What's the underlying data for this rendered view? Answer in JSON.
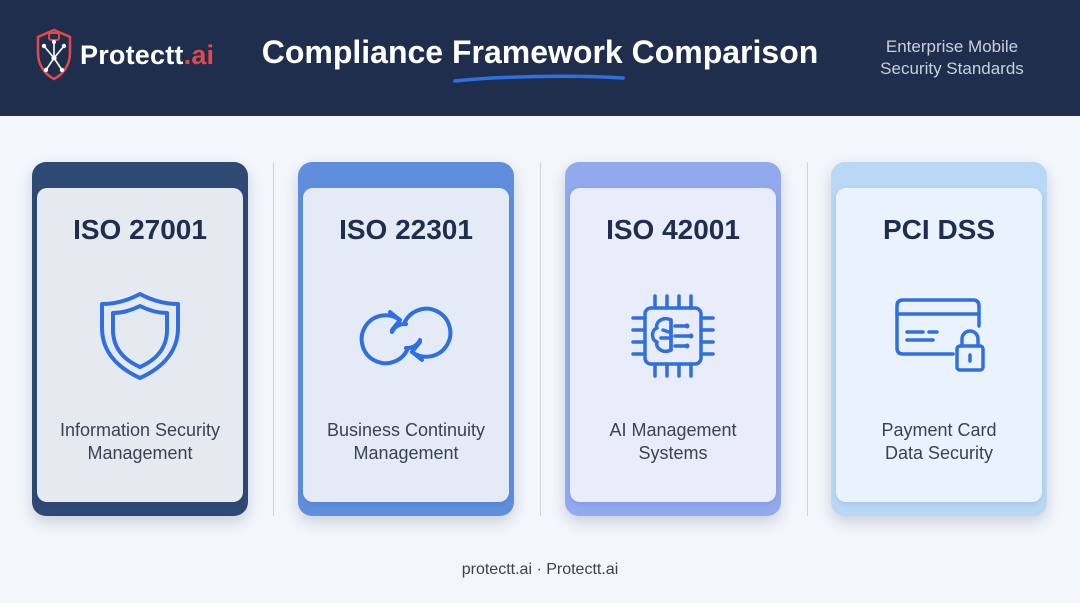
{
  "header": {
    "brand_main": "Protectt",
    "brand_suffix": ".ai",
    "title": "Compliance Framework Comparison",
    "tagline_line1": "Enterprise Mobile",
    "tagline_line2": "Security Standards"
  },
  "cards": [
    {
      "title": "ISO 27001",
      "desc_line1": "Information Security",
      "desc_line2": "Management",
      "icon": "shield-icon",
      "frame_color": "#2e4a74",
      "panel_color": "#e5e9f0"
    },
    {
      "title": "ISO 22301",
      "desc_line1": "Business Continuity",
      "desc_line2": "Management",
      "icon": "continuity-arrows-icon",
      "frame_color": "#5f8fdc",
      "panel_color": "#e4ebf7"
    },
    {
      "title": "ISO 42001",
      "desc_line1": "AI Management",
      "desc_line2": "Systems",
      "icon": "ai-chip-icon",
      "frame_color": "#93a9ee",
      "panel_color": "#e8ecfb"
    },
    {
      "title": "PCI DSS",
      "desc_line1": "Payment Card",
      "desc_line2": "Data Security",
      "icon": "payment-card-lock-icon",
      "frame_color": "#b8d8f6",
      "panel_color": "#eaf3fd"
    }
  ],
  "footer": {
    "text": "protectt.ai · Protectt.ai"
  },
  "colors": {
    "header_bg": "#1f2e4d",
    "accent_underline": "#2f6fe0",
    "brand_accent": "#e14a4a",
    "icon_blue": "#2f6fe0"
  }
}
